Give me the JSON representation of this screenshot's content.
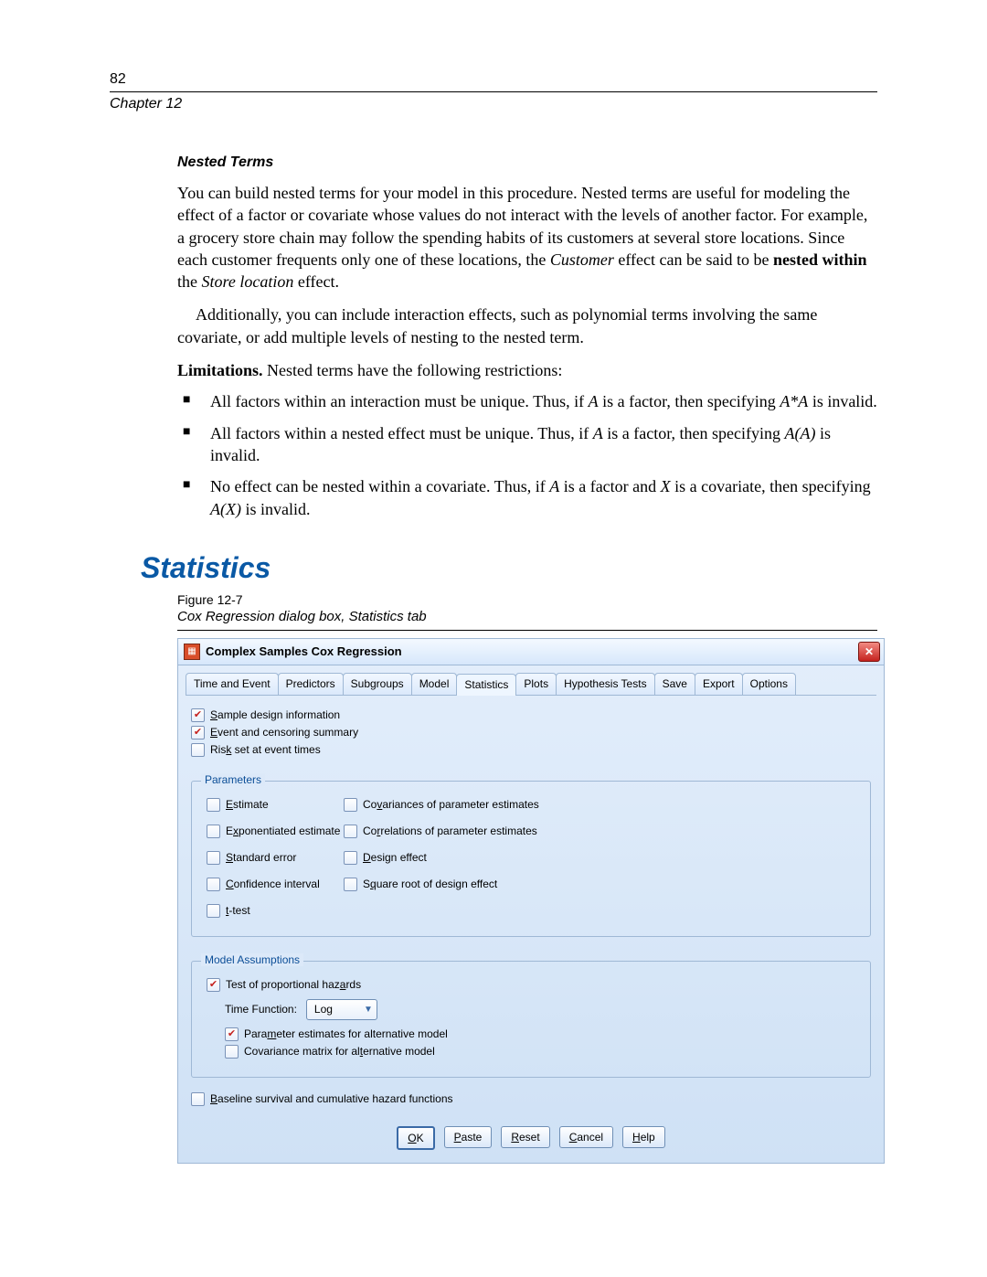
{
  "page_number": "82",
  "chapter_label": "Chapter 12",
  "nested_terms": {
    "heading": "Nested Terms",
    "p1_a": "You can build nested terms for your model in this procedure. Nested terms are useful for modeling the effect of a factor or covariate whose values do not interact with the levels of another factor. For example, a grocery store chain may follow the spending habits of its customers at several store locations. Since each customer frequents only one of these locations, the ",
    "customer_em": "Customer",
    "p1_b": " effect can be said to be ",
    "nested_within_bold": "nested within",
    "p1_c": " the ",
    "store_em": "Store location",
    "p1_d": " effect.",
    "p2": "Additionally, you can include interaction effects, such as polynomial terms involving the same covariate, or add multiple levels of nesting to the nested term.",
    "limit_label": "Limitations.",
    "limit_text": " Nested terms have the following restrictions:",
    "bullets": {
      "b1_a": "All factors within an interaction must be unique. Thus, if ",
      "A": "A",
      "b1_b": " is a factor, then specifying ",
      "AA": "A*A",
      "b1_c": " is invalid.",
      "b2_a": "All factors within a nested effect must be unique. Thus, if ",
      "b2_b": " is a factor, then specifying ",
      "AAp": "A(A)",
      "b2_c": " is invalid.",
      "b3_a": "No effect can be nested within a covariate. Thus, if ",
      "b3_b": " is a factor and ",
      "X": "X",
      "b3_c": " is a covariate, then specifying ",
      "AX": "A(X)",
      "b3_d": " is invalid."
    }
  },
  "statistics_heading": "Statistics",
  "figure": {
    "label": "Figure 12-7",
    "caption": "Cox Regression dialog box, Statistics tab"
  },
  "dialog": {
    "title": "Complex Samples Cox Regression",
    "tabs": [
      "Time and Event",
      "Predictors",
      "Subgroups",
      "Model",
      "Statistics",
      "Plots",
      "Hypothesis Tests",
      "Save",
      "Export",
      "Options"
    ],
    "active_tab_index": 4,
    "top_checks": [
      {
        "label": "Sample design information",
        "checked": true,
        "u": 0
      },
      {
        "label": "Event and censoring summary",
        "checked": true,
        "u": 0
      },
      {
        "label": "Risk set at event times",
        "checked": false,
        "u": 3
      }
    ],
    "parameters": {
      "title": "Parameters",
      "left": [
        {
          "label": "Estimate",
          "checked": false,
          "u": 0
        },
        {
          "label": "Exponentiated estimate",
          "checked": false,
          "u": 1
        },
        {
          "label": "Standard error",
          "checked": false,
          "u": 0
        },
        {
          "label": "Confidence interval",
          "checked": false,
          "u": 0
        },
        {
          "label": "t-test",
          "checked": false,
          "u": 0
        }
      ],
      "right": [
        {
          "label": "Covariances of parameter estimates",
          "checked": false,
          "u": 2
        },
        {
          "label": "Correlations of parameter estimates",
          "checked": false,
          "u": 2
        },
        {
          "label": "Design effect",
          "checked": false,
          "u": 0
        },
        {
          "label": "Square root of design effect",
          "checked": false,
          "u": 1
        }
      ]
    },
    "model_assumptions": {
      "title": "Model Assumptions",
      "test": {
        "label": "Test of proportional hazards",
        "checked": true,
        "u": 24
      },
      "time_function_label": "Time Function:",
      "time_function_value": "Log",
      "param_est": {
        "label": "Parameter estimates for alternative model",
        "checked": true,
        "u": 4
      },
      "cov_matrix": {
        "label": "Covariance matrix for alternative model",
        "checked": false,
        "u": 24
      }
    },
    "baseline": {
      "label": "Baseline survival and cumulative hazard functions",
      "checked": false,
      "u": 0
    },
    "buttons": [
      "OK",
      "Paste",
      "Reset",
      "Cancel",
      "Help"
    ]
  }
}
